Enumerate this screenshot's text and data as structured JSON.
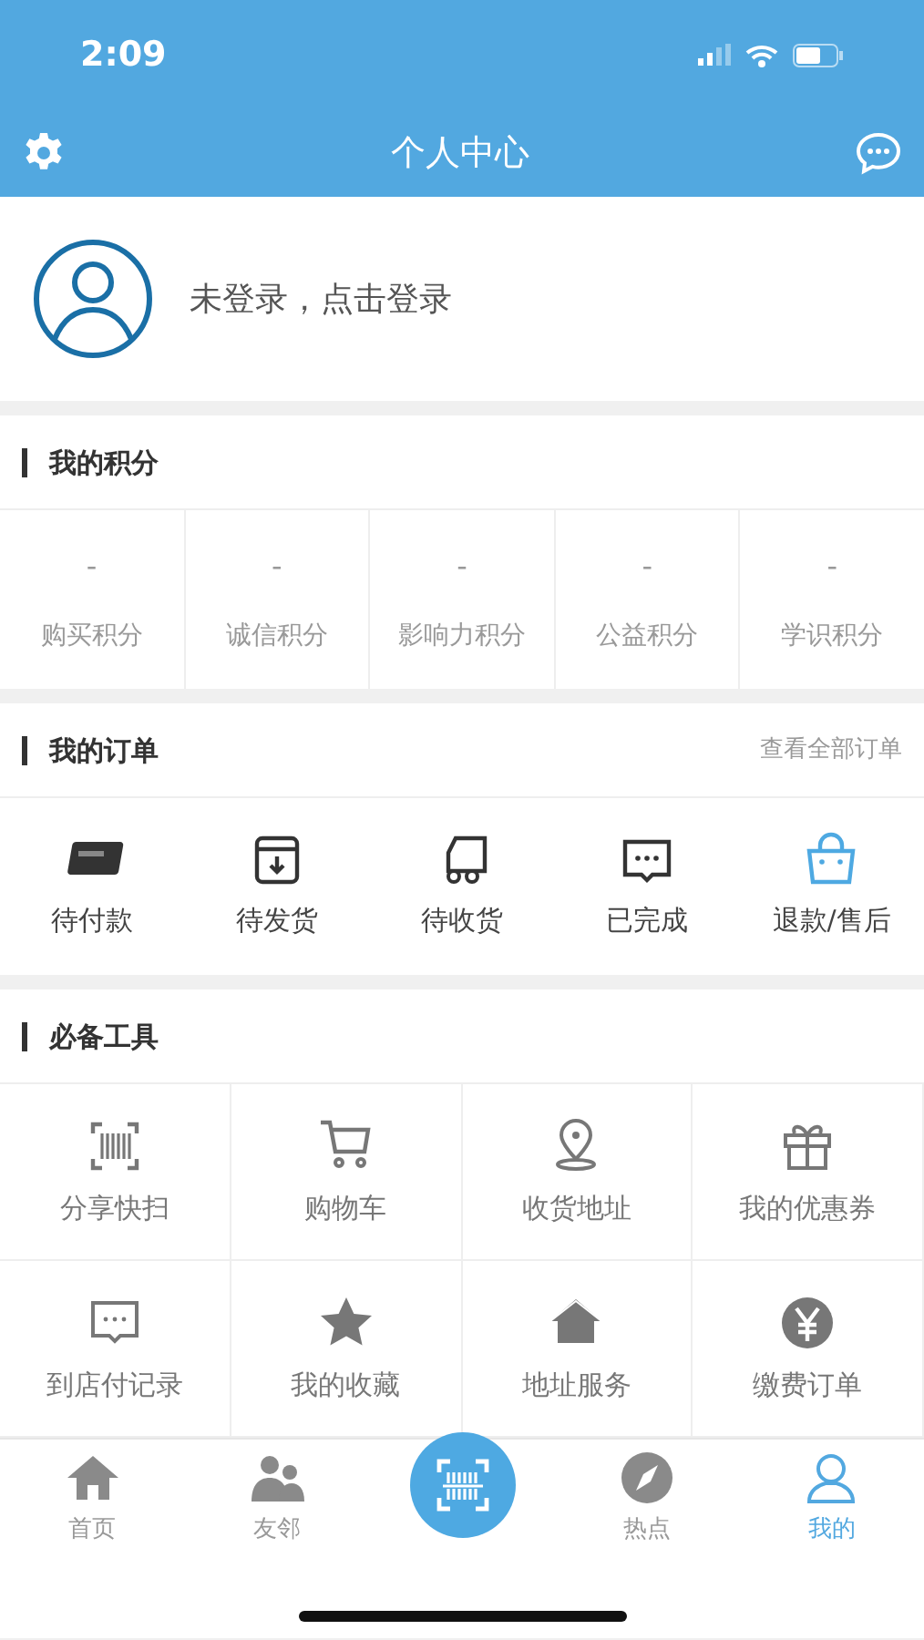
{
  "status_bar": {
    "time": "2:09"
  },
  "nav": {
    "title": "个人中心"
  },
  "profile": {
    "login_text": "未登录，点击登录"
  },
  "points": {
    "title": "我的积分",
    "items": [
      {
        "value": "-",
        "label": "购买积分"
      },
      {
        "value": "-",
        "label": "诚信积分"
      },
      {
        "value": "-",
        "label": "影响力积分"
      },
      {
        "value": "-",
        "label": "公益积分"
      },
      {
        "value": "-",
        "label": "学识积分"
      }
    ]
  },
  "orders": {
    "title": "我的订单",
    "link": "查看全部订单",
    "items": [
      {
        "label": "待付款"
      },
      {
        "label": "待发货"
      },
      {
        "label": "待收货"
      },
      {
        "label": "已完成"
      },
      {
        "label": "退款/售后"
      }
    ]
  },
  "tools": {
    "title": "必备工具",
    "items": [
      {
        "label": "分享快扫"
      },
      {
        "label": "购物车"
      },
      {
        "label": "收货地址"
      },
      {
        "label": "我的优惠券"
      },
      {
        "label": "到店付记录"
      },
      {
        "label": "我的收藏"
      },
      {
        "label": "地址服务"
      },
      {
        "label": "缴费订单"
      }
    ]
  },
  "tab_bar": [
    {
      "kind": "tab",
      "label": "首页",
      "selected": false
    },
    {
      "kind": "tab",
      "label": "友邻",
      "selected": false
    },
    {
      "kind": "scan",
      "selected": false
    },
    {
      "kind": "tab",
      "label": "热点",
      "selected": false
    },
    {
      "kind": "tab",
      "label": "我的",
      "selected": true
    }
  ]
}
